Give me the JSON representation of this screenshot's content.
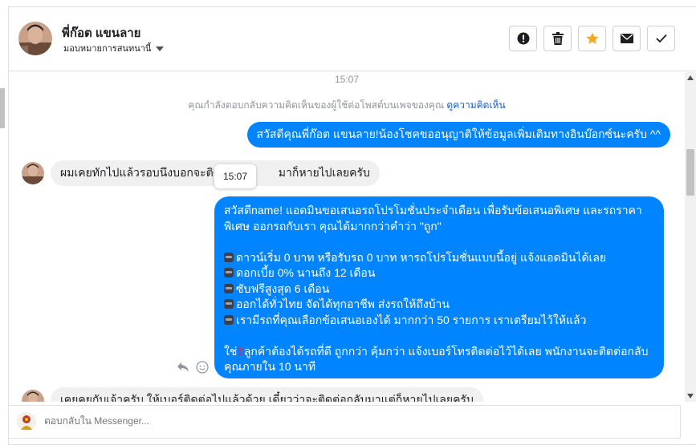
{
  "header": {
    "contact_name": "พี่ก๊อต แขนลาย",
    "assign_label": "มอบหมายการสนทนานี้",
    "actions": [
      {
        "name": "spam-button",
        "icon": "exclamation-circle-icon"
      },
      {
        "name": "delete-button",
        "icon": "trash-icon"
      },
      {
        "name": "star-button",
        "icon": "star-icon"
      },
      {
        "name": "mark-unread-button",
        "icon": "envelope-icon"
      },
      {
        "name": "mark-done-button",
        "icon": "checkmark-icon"
      }
    ]
  },
  "chat": {
    "timestamp": "15:07",
    "info_text": "คุณกำลังตอบกลับความคิดเห็นของผู้ใช้ต่อโพสต์บนเพจของคุณ",
    "info_link": "ดูความคิดเห็น",
    "messages": [
      {
        "direction": "outgoing",
        "text": "สวัสดีคุณพี่ก๊อต แขนลาย!น้องโชคขออนุญาติให้ข้อมูลเพิ่มเติมทางอินบ๊อกซ์นะครับ ^^"
      },
      {
        "direction": "incoming",
        "text_start": "ผมเคยทักไปแล้วรอบนึงบอกจะติด",
        "text_end": "มาก็หายไปเลยครับ"
      },
      {
        "direction": "outgoing",
        "intro": "สวัสดีname! แอดมินขอเสนอรถโปรโมชั่นประจำเดือน เพื่อรับข้อเสนอพิเศษ และรถราคาพิเศษ ออกรถกับเรา คุณได้มากกว่าคำว่า \"ถูก\"",
        "bullets": [
          "ดาวน์เริ่ม 0 บาท หรือรับรถ 0 บาท หารถโปรโมชั่นแบบนี้อยู่ แจ้งแอดมินได้เลย",
          "ดอกเบี้ย 0% นานถึง 12 เดือน",
          "ซับฟรีสูงสุด 6 เดือน",
          "ออกได้ทั่วไทย จัดได้ทุกอาชีพ ส่งรถให้ถึงบ้าน",
          "เรามีรถที่คุณเลือกข้อเสนอเองได้ มากกว่า 50 รายการ เราเตรียมไว้ให้แล้ว"
        ],
        "closing_prefix": "ใช่",
        "closing_mark": "‼",
        "closing": "ลูกค้าต้องได้รถที่ดี ถูกกว่า คุ้มกว่า แจ้งเบอร์โทรติดต่อไว้ได้เลย พนักงานจะติดต่อกลับคุณภายใน 10 นาที"
      },
      {
        "direction": "incoming",
        "text": "เคยคุยกับเจ้าครับ ให้เบอร์ติดต่อไปแล้วด้วย เดี๋ยวว่าจะติดต่อกลับมาแต่ก็หายไปเลยครับ"
      }
    ],
    "tooltip_time": "15:07"
  },
  "reply": {
    "placeholder": "ตอบกลับใน Messenger..."
  },
  "colors": {
    "accent": "#0084ff",
    "star": "#f5a623",
    "link": "#1d5ec6"
  }
}
